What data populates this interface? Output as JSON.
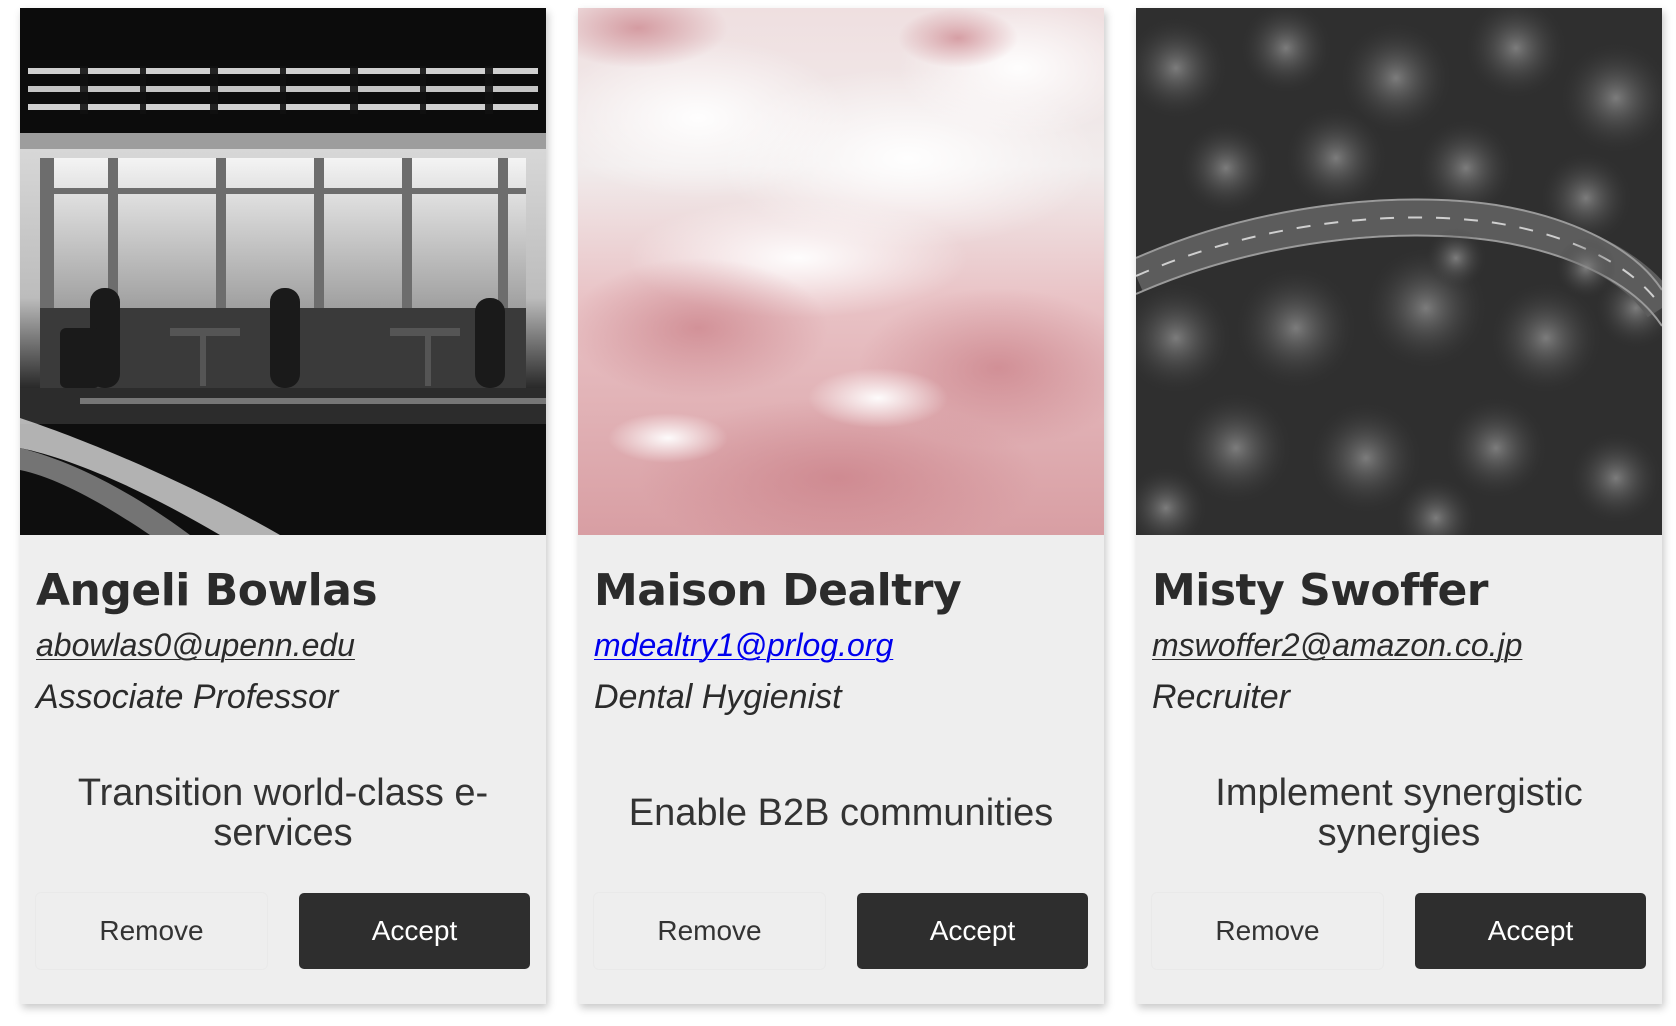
{
  "cards": [
    {
      "image_icon": "diner-photo",
      "name": "Angeli Bowlas",
      "email": "abowlas0@upenn.edu",
      "role": "Associate Professor",
      "blurb": "Transition world-class e-services",
      "remove_label": "Remove",
      "accept_label": "Accept"
    },
    {
      "image_icon": "pink-texture-photo",
      "name": "Maison Dealtry",
      "email": "mdealtry1@prlog.org",
      "role": "Dental Hygienist",
      "blurb": "Enable B2B communities",
      "remove_label": "Remove",
      "accept_label": "Accept"
    },
    {
      "image_icon": "forest-road-photo",
      "name": "Misty Swoffer",
      "email": "mswoffer2@amazon.co.jp",
      "role": "Recruiter",
      "blurb": "Implement synergistic synergies",
      "remove_label": "Remove",
      "accept_label": "Accept"
    }
  ],
  "colors": {
    "card_bg": "#eeeeee",
    "accept_bg": "#2e2e2e",
    "text": "#2b2b2b",
    "link": "#0000ee"
  }
}
